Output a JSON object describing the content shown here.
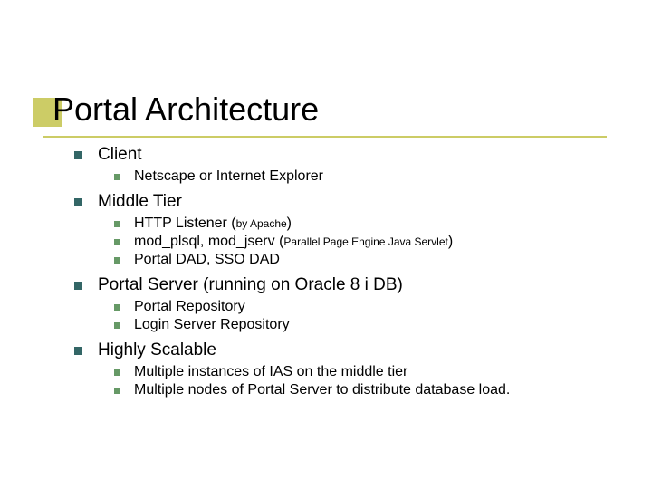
{
  "title": "Portal Architecture",
  "items": {
    "client": {
      "label": "Client",
      "sub": {
        "a": "Netscape or Internet Explorer"
      }
    },
    "middle": {
      "label": "Middle Tier",
      "sub": {
        "a_pre": "HTTP Listener (",
        "a_small": "by Apache",
        "a_post": ")",
        "b_pre": "mod_plsql, mod_jserv (",
        "b_small": "Parallel Page Engine Java Servlet",
        "b_post": ")",
        "c": "Portal DAD, SSO DAD"
      }
    },
    "portal": {
      "label": "Portal Server (running on Oracle 8 i DB)",
      "sub": {
        "a": "Portal Repository",
        "b": "Login Server Repository"
      }
    },
    "scalable": {
      "label": "Highly Scalable",
      "sub": {
        "a": "Multiple instances of IAS on the middle tier",
        "b": "Multiple nodes of Portal Server to distribute database load."
      }
    }
  }
}
